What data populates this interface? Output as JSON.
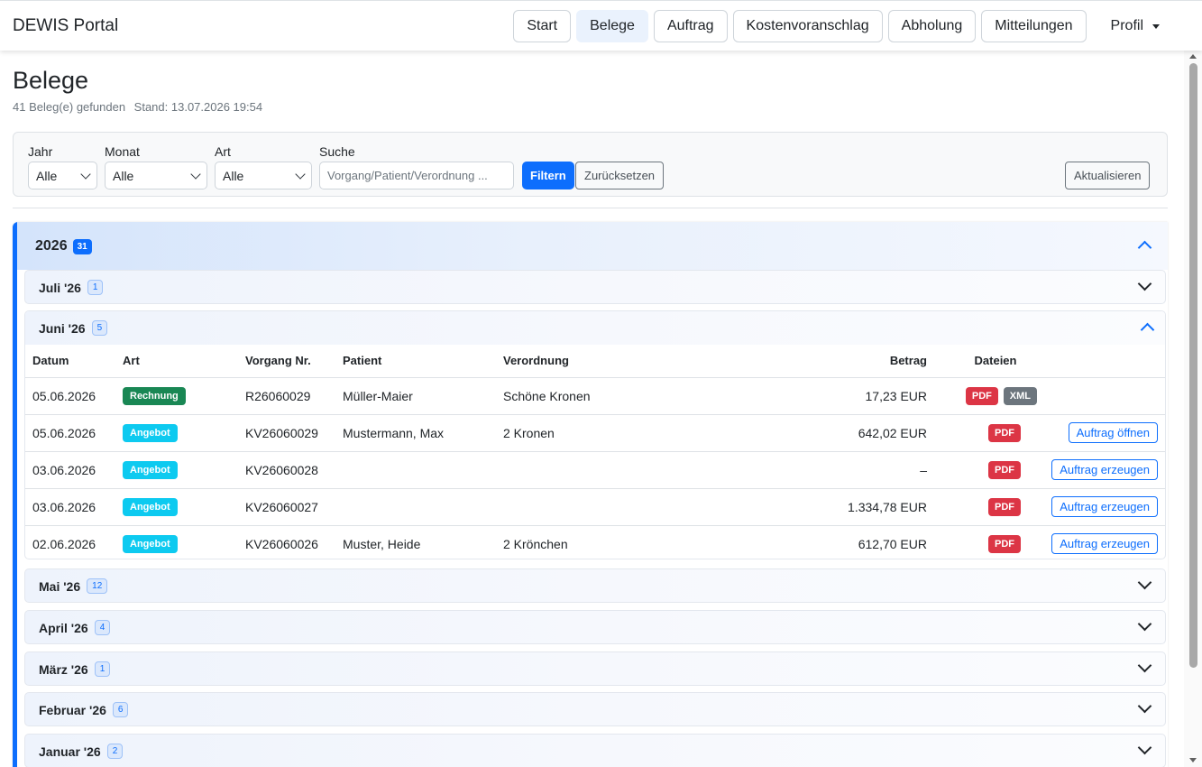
{
  "app": {
    "brand": "DEWIS Portal"
  },
  "nav": {
    "items": [
      "Start",
      "Belege",
      "Auftrag",
      "Kostenvoranschlag",
      "Abholung",
      "Mitteilungen"
    ],
    "active": "Belege",
    "profile": "Profil"
  },
  "header": {
    "title": "Belege",
    "count_text": "41 Beleg(e) gefunden",
    "stand_text": "Stand: 13.07.2026 19:54"
  },
  "filter": {
    "jahr_label": "Jahr",
    "jahr_value": "Alle",
    "monat_label": "Monat",
    "monat_value": "Alle",
    "art_label": "Art",
    "art_value": "Alle",
    "suche_label": "Suche",
    "suche_placeholder": "Vorgang/Patient/Verordnung ...",
    "filter_button": "Filtern",
    "reset_button": "Zurücksetzen",
    "refresh_button": "Aktualisieren"
  },
  "year": {
    "label": "2026",
    "count": "31"
  },
  "months": [
    {
      "label": "Juli '26",
      "count": "1"
    },
    {
      "label": "Juni '26",
      "count": "5"
    },
    {
      "label": "Mai '26",
      "count": "12"
    },
    {
      "label": "April '26",
      "count": "4"
    },
    {
      "label": "März '26",
      "count": "1"
    },
    {
      "label": "Februar '26",
      "count": "6"
    },
    {
      "label": "Januar '26",
      "count": "2"
    }
  ],
  "table": {
    "columns": [
      "Datum",
      "Art",
      "Vorgang Nr.",
      "Patient",
      "Verordnung",
      "Betrag",
      "Dateien"
    ],
    "rows": [
      {
        "datum": "05.06.2026",
        "art": "Rechnung",
        "vorgang": "R26060029",
        "patient": "Müller-Maier",
        "verordnung": "Schöne Kronen",
        "betrag": "17,23 EUR",
        "pdf": "PDF",
        "xml": "XML",
        "action": ""
      },
      {
        "datum": "05.06.2026",
        "art": "Angebot",
        "vorgang": "KV26060029",
        "patient": "Mustermann, Max",
        "verordnung": "2 Kronen",
        "betrag": "642,02 EUR",
        "pdf": "PDF",
        "xml": "",
        "action": "Auftrag öffnen"
      },
      {
        "datum": "03.06.2026",
        "art": "Angebot",
        "vorgang": "KV26060028",
        "patient": "",
        "verordnung": "",
        "betrag": "–",
        "pdf": "PDF",
        "xml": "",
        "action": "Auftrag erzeugen"
      },
      {
        "datum": "03.06.2026",
        "art": "Angebot",
        "vorgang": "KV26060027",
        "patient": "",
        "verordnung": "",
        "betrag": "1.334,78 EUR",
        "pdf": "PDF",
        "xml": "",
        "action": "Auftrag erzeugen"
      },
      {
        "datum": "02.06.2026",
        "art": "Angebot",
        "vorgang": "KV26060026",
        "patient": "Muster, Heide",
        "verordnung": "2 Krönchen",
        "betrag": "612,70 EUR",
        "pdf": "PDF",
        "xml": "",
        "action": "Auftrag erzeugen"
      }
    ]
  },
  "colors": {
    "primary": "#0d6efd",
    "success": "#198754",
    "info": "#0dcaf0",
    "danger": "#dc3545",
    "secondary": "#6c757d"
  },
  "icons": {
    "dropdown": "chevron-down-icon",
    "collapse": "chevron-up-icon",
    "expand": "chevron-down-icon"
  }
}
